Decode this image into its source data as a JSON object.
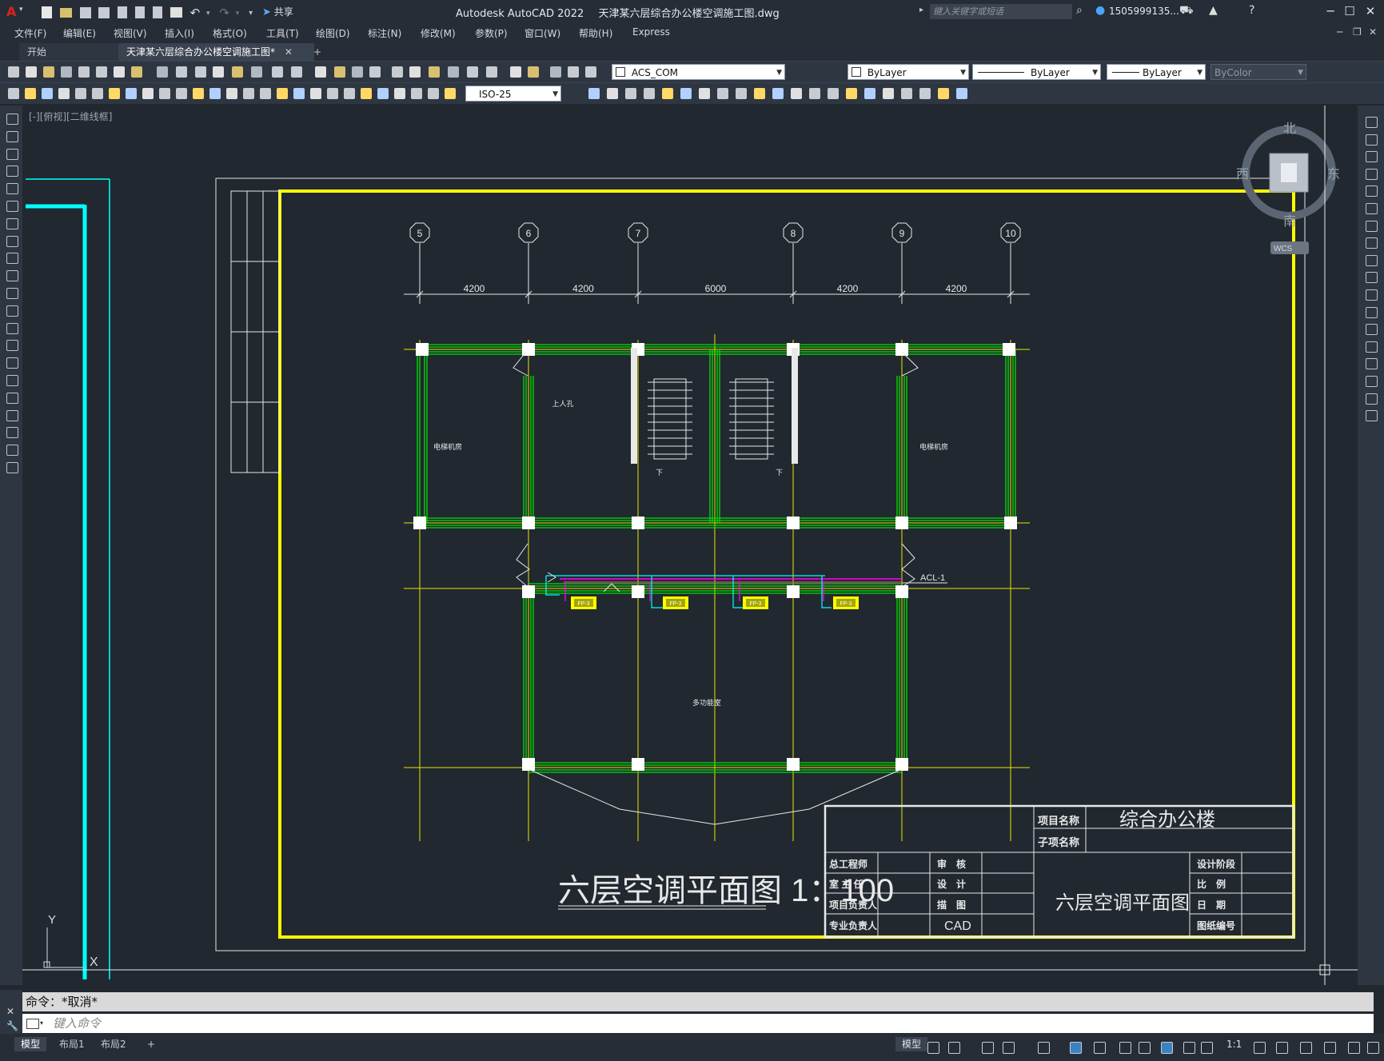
{
  "window": {
    "app_title": "Autodesk AutoCAD 2022",
    "file_title": "天津某六层综合办公楼空调施工图.dwg",
    "share_label": "共享",
    "search_placeholder": "键入关键字或短语",
    "user_name": "1505999135..."
  },
  "menu": [
    "文件(F)",
    "编辑(E)",
    "视图(V)",
    "插入(I)",
    "格式(O)",
    "工具(T)",
    "绘图(D)",
    "标注(N)",
    "修改(M)",
    "参数(P)",
    "窗口(W)",
    "帮助(H)",
    "Express"
  ],
  "tabs": {
    "start": "开始",
    "active": "天津某六层综合办公楼空调施工图*",
    "close": "✕",
    "add": "+"
  },
  "toolbar": {
    "layer": "ACS_COM",
    "color": "ByLayer",
    "linetype": "ByLayer",
    "lineweight": "ByLayer",
    "plotstyle": "ByColor",
    "dimstyle": "ISO-25"
  },
  "viewport": {
    "label": "[-][俯视][二维线框]",
    "compass": {
      "north": "北",
      "south": "南",
      "east": "东",
      "west": "西",
      "wcs": "WCS"
    },
    "ucs": {
      "x": "X",
      "y": "Y"
    }
  },
  "drawing": {
    "axes": [
      "5",
      "6",
      "7",
      "8",
      "9",
      "10"
    ],
    "dimensions": [
      "4200",
      "4200",
      "6000",
      "4200",
      "4200"
    ],
    "rooms": [
      "电梯机房",
      "上人孔",
      "电梯机房",
      "多功能室"
    ],
    "stair_marks": [
      "下",
      "下"
    ],
    "duct_label": "ACL-1",
    "units": [
      "FP-3",
      "FP-3",
      "FP-3",
      "FP-3"
    ],
    "plan_title": "六层空调平面图 1：100"
  },
  "titleblock": {
    "project_name_label": "项目名称",
    "project_name": "综合办公楼",
    "subitem_label": "子项名称",
    "roles_left": [
      "总工程师",
      "室 主 任",
      "项目负责人",
      "专业负责人"
    ],
    "roles_mid": [
      "审　核",
      "设　计",
      "描　图",
      "CAD"
    ],
    "drawing_name": "六层空调平面图",
    "roles_right": [
      "设计阶段",
      "比　例",
      "日　期",
      "图纸编号"
    ]
  },
  "command": {
    "history": "命令：*取消*",
    "placeholder": "键入命令"
  },
  "layout_tabs": [
    "模型",
    "布局1",
    "布局2"
  ],
  "status": {
    "model": "模型",
    "scale": "1:1"
  },
  "colors": {
    "background": "#212830",
    "frame_yellow": "#ffff00",
    "axis_yellow": "#e6e600",
    "wall_green": "#00e000",
    "cyan": "#00ffff",
    "magenta": "#ff00ff"
  }
}
